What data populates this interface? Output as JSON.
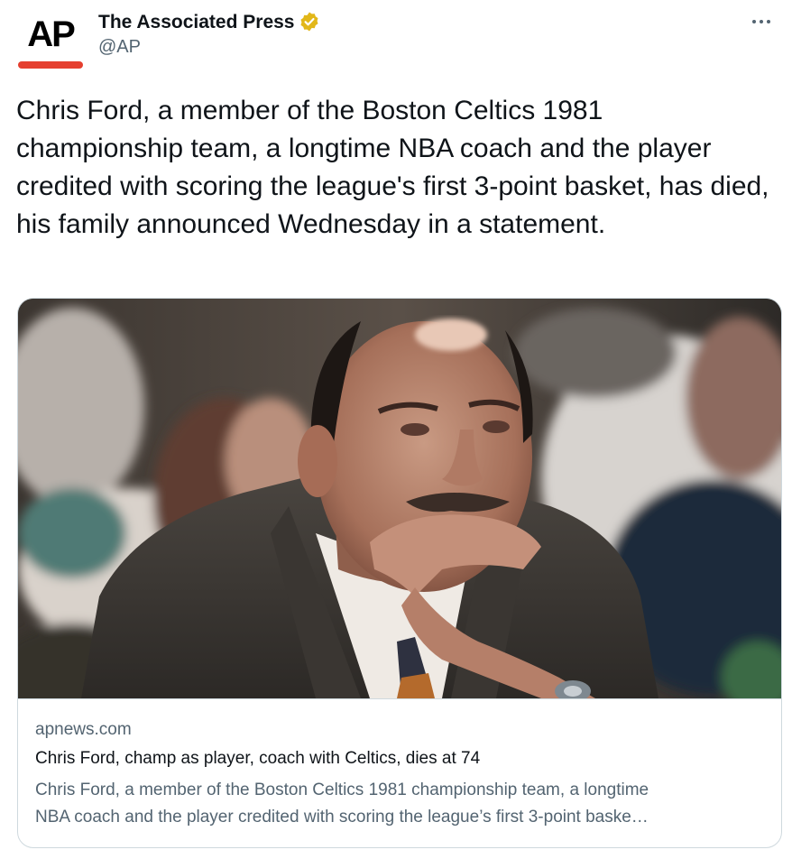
{
  "account": {
    "display_name": "The Associated Press",
    "handle": "@AP",
    "avatar_logo": "AP",
    "verified_icon": "verified-badge-icon",
    "verified_color": "#e2b719",
    "more_icon": "more-options-icon"
  },
  "tweet": {
    "text": "Chris Ford, a member of the Boston Celtics 1981 championship team, a longtime NBA coach and the player credited with scoring the league's first 3-point basket, has died, his family announced Wednesday in a statement."
  },
  "link_card": {
    "image": "photo-chris-ford-courtside",
    "domain": "apnews.com",
    "title": "Chris Ford, champ as player, coach with Celtics, dies at 74",
    "description_line1": "Chris Ford, a member of the Boston Celtics 1981 championship team, a longtime",
    "description_line2": "NBA coach and the player credited with scoring the league’s first 3-point baske…"
  },
  "colors": {
    "text_primary": "#0f1419",
    "text_secondary": "#536471",
    "border": "#cfd9de",
    "ap_red": "#e53f2f"
  }
}
